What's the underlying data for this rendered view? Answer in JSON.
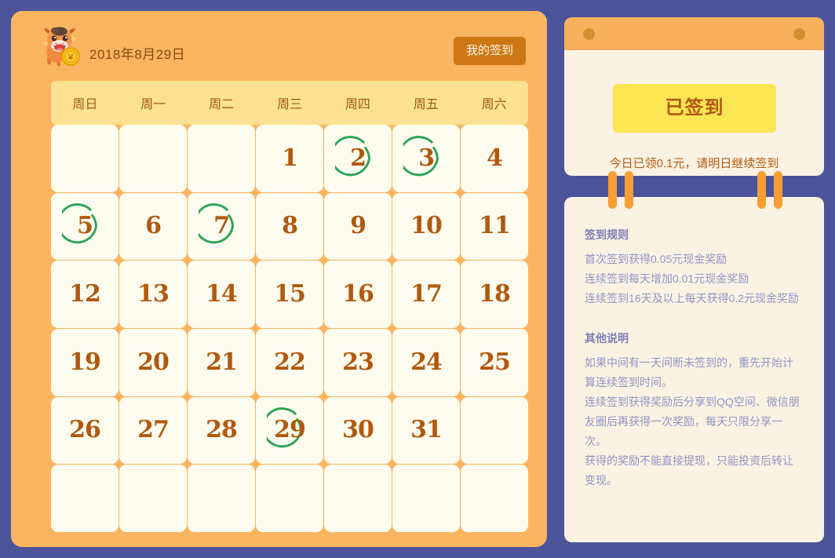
{
  "theme": {
    "page_background": "#4c5499",
    "calendar_card_bg": "#fbb45f",
    "weekday_bar_bg": "#fbe191",
    "date_cell_bg": "#fdfcee",
    "date_number_color": "#b0590f",
    "checkmark_color": "#2aa455",
    "my_checkin_button_bg": "#cc7714",
    "signed_in_button_bg": "#fce552",
    "panel_bg": "#fcf2e3",
    "rules_title_color": "#7c7fb4",
    "rules_text_color": "#9094c4",
    "binder_strip_color": "#f89e32"
  },
  "calendar": {
    "mascot_icon": "cow-mascot-with-coin-icon",
    "date_label": "2018年8月29日",
    "my_checkin_label": "我的签到",
    "weekdays": [
      "周日",
      "周一",
      "周二",
      "周三",
      "周四",
      "周五",
      "周六"
    ],
    "days": [
      {
        "num": "",
        "checked": false
      },
      {
        "num": "",
        "checked": false
      },
      {
        "num": "",
        "checked": false
      },
      {
        "num": "1",
        "checked": false
      },
      {
        "num": "2",
        "checked": true
      },
      {
        "num": "3",
        "checked": true
      },
      {
        "num": "4",
        "checked": false
      },
      {
        "num": "5",
        "checked": true
      },
      {
        "num": "6",
        "checked": false
      },
      {
        "num": "7",
        "checked": true
      },
      {
        "num": "8",
        "checked": false
      },
      {
        "num": "9",
        "checked": false
      },
      {
        "num": "10",
        "checked": false
      },
      {
        "num": "11",
        "checked": false
      },
      {
        "num": "12",
        "checked": false
      },
      {
        "num": "13",
        "checked": false
      },
      {
        "num": "14",
        "checked": false
      },
      {
        "num": "15",
        "checked": false
      },
      {
        "num": "16",
        "checked": false
      },
      {
        "num": "17",
        "checked": false
      },
      {
        "num": "18",
        "checked": false
      },
      {
        "num": "19",
        "checked": false
      },
      {
        "num": "20",
        "checked": false
      },
      {
        "num": "21",
        "checked": false
      },
      {
        "num": "22",
        "checked": false
      },
      {
        "num": "23",
        "checked": false
      },
      {
        "num": "24",
        "checked": false
      },
      {
        "num": "25",
        "checked": false
      },
      {
        "num": "26",
        "checked": false
      },
      {
        "num": "27",
        "checked": false
      },
      {
        "num": "28",
        "checked": false
      },
      {
        "num": "29",
        "checked": true
      },
      {
        "num": "30",
        "checked": false
      },
      {
        "num": "31",
        "checked": false
      },
      {
        "num": "",
        "checked": false
      },
      {
        "num": "",
        "checked": false
      },
      {
        "num": "",
        "checked": false
      },
      {
        "num": "",
        "checked": false
      },
      {
        "num": "",
        "checked": false
      },
      {
        "num": "",
        "checked": false
      },
      {
        "num": "",
        "checked": false
      },
      {
        "num": "",
        "checked": false
      }
    ]
  },
  "checkin_panel": {
    "binder_hole_icon": "binder-hole-icon",
    "signed_in_label": "已签到",
    "note": "今日已领0.1元，请明日继续签到",
    "binding_strip_icon": "binder-strip-icon"
  },
  "rules_panel": {
    "rules": {
      "title": "签到规则",
      "lines": [
        "首次签到获得0.05元现金奖励",
        "连续签到每天增加0.01元现金奖励",
        "连续签到16天及以上每天获得0.2元现金奖励"
      ]
    },
    "other": {
      "title": "其他说明",
      "lines": [
        "如果中间有一天间断未签到的，重先开始计算连续签到时间。",
        "连续签到获得奖励后分享到QQ空间、微信朋友圈后再获得一次奖励，每天只限分享一次。",
        "获得的奖励不能直接提现，只能投资后转让变现。"
      ]
    }
  }
}
